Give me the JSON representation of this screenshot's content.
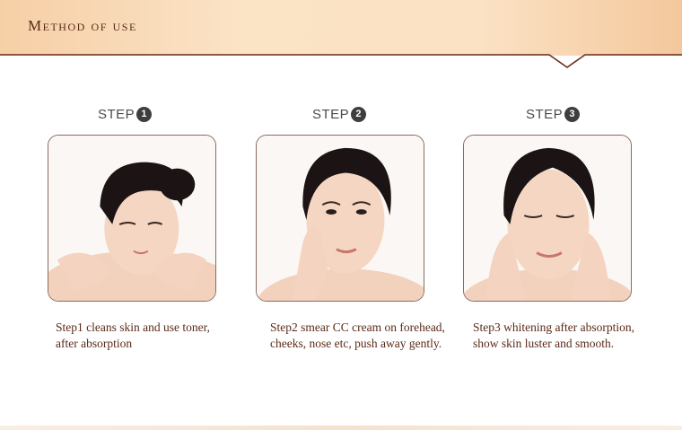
{
  "header": {
    "title": "Method of use"
  },
  "steps": [
    {
      "label": "STEP",
      "number": "1",
      "caption": "Step1 cleans skin and use toner, after absorption"
    },
    {
      "label": "STEP",
      "number": "2",
      "caption": "Step2  smear CC cream on forehead, cheeks, nose etc, push away gently."
    },
    {
      "label": "STEP",
      "number": "3",
      "caption": "Step3 whitening after absorption, show skin luster and smooth."
    }
  ],
  "colors": {
    "header_bg": "#fbe2c4",
    "title": "#5a2a18",
    "frame": "#8b6a5f",
    "badge": "#3e3e3e"
  }
}
